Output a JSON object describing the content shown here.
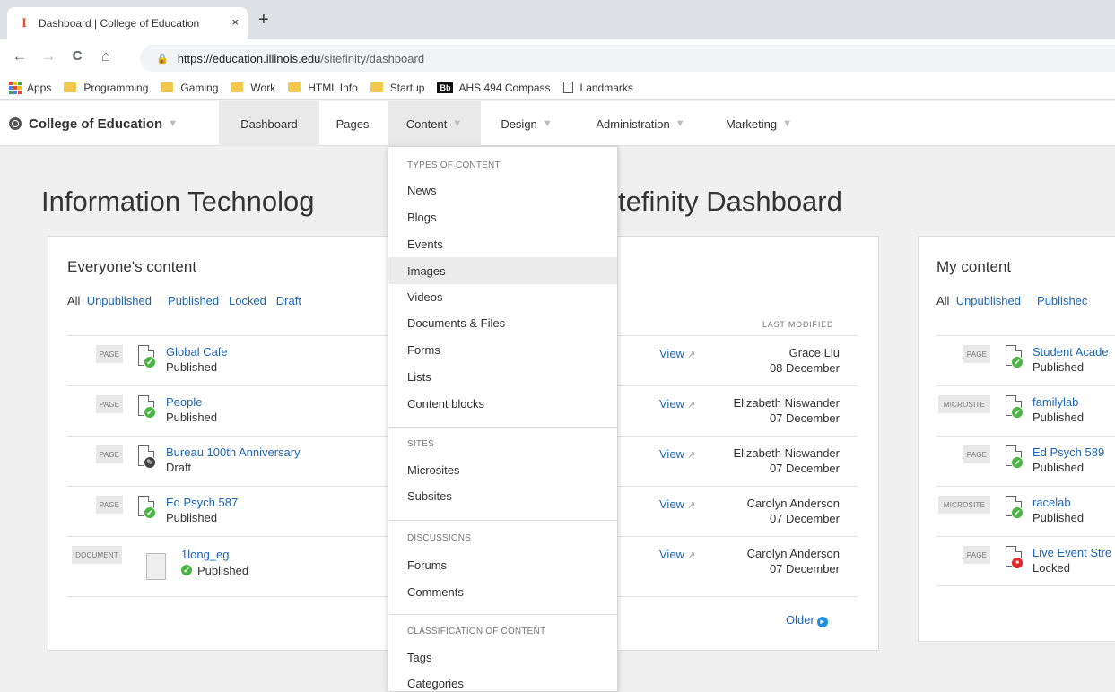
{
  "browser": {
    "tab_title": "Dashboard | College of Education",
    "tab_close": "×",
    "new_tab": "+",
    "favicon": "I",
    "url_host": "https://education.illinois.edu",
    "url_path": "/sitefinity/dashboard",
    "back_icon": "←",
    "forward_icon": "→",
    "reload_icon": "C",
    "home_icon": "⌂",
    "lock_icon": "🔒",
    "bookmarks": [
      "Apps",
      "Programming",
      "Gaming",
      "Work",
      "HTML Info",
      "Startup",
      "AHS 494 Compass",
      "Landmarks"
    ],
    "bb_label": "Bb"
  },
  "nav": {
    "site_name": "College of Education",
    "caret": "▼",
    "items": [
      "Dashboard",
      "Pages",
      "Content",
      "Design",
      "Administration",
      "Marketing"
    ]
  },
  "page": {
    "title": "Information Technology Services Sitefinity Dashboard",
    "title_left": "Information Technolog",
    "title_right": "tefinity Dashboard"
  },
  "everyone": {
    "heading": "Everyone's content",
    "filters": [
      "All",
      "Unpublished",
      "Published",
      "Locked",
      "Draft"
    ],
    "last_modified": "LAST MODIFIED",
    "view_label": "View",
    "older": "Older",
    "rows": [
      {
        "tag": "PAGE",
        "title": "Global Cafe",
        "status": "Published",
        "who": "Grace Liu",
        "date": "08 December"
      },
      {
        "tag": "PAGE",
        "title": "People",
        "status": "Published",
        "who": "Elizabeth Niswander",
        "date": "07 December"
      },
      {
        "tag": "PAGE",
        "title": "Bureau 100th Anniversary",
        "status": "Draft",
        "who": "Elizabeth Niswander",
        "date": "07 December"
      },
      {
        "tag": "PAGE",
        "title": "Ed Psych 587",
        "status": "Published",
        "who": "Carolyn Anderson",
        "date": "07 December"
      },
      {
        "tag": "DOCUMENT",
        "title": "1long_eg",
        "status": "Published",
        "who": "Carolyn Anderson",
        "date": "07 December"
      }
    ]
  },
  "mine": {
    "heading": "My content",
    "filters": [
      "All",
      "Unpublished",
      "Publishec"
    ],
    "rows": [
      {
        "tag": "PAGE",
        "title": "Student Acade",
        "status": "Published"
      },
      {
        "tag": "MICROSITE",
        "title": "familylab",
        "status": "Published"
      },
      {
        "tag": "PAGE",
        "title": "Ed Psych 589",
        "status": "Published"
      },
      {
        "tag": "MICROSITE",
        "title": "racelab",
        "status": "Published"
      },
      {
        "tag": "PAGE",
        "title": "Live Event Stre",
        "status": "Locked"
      }
    ]
  },
  "dropdown": {
    "sections": {
      "types": "TYPES OF CONTENT",
      "sites": "SITES",
      "discussions": "DISCUSSIONS",
      "classification": "CLASSIFICATION OF CONTENT"
    },
    "types": [
      "News",
      "Blogs",
      "Events",
      "Images",
      "Videos",
      "Documents & Files",
      "Forms",
      "Lists",
      "Content blocks"
    ],
    "sites": [
      "Microsites",
      "Subsites"
    ],
    "discussions": [
      "Forums",
      "Comments"
    ],
    "classification": [
      "Tags",
      "Categories"
    ]
  },
  "icons": {
    "check": "✔",
    "pencil": "✎",
    "locked": "■",
    "external": "↗",
    "older_arrow": "►"
  }
}
